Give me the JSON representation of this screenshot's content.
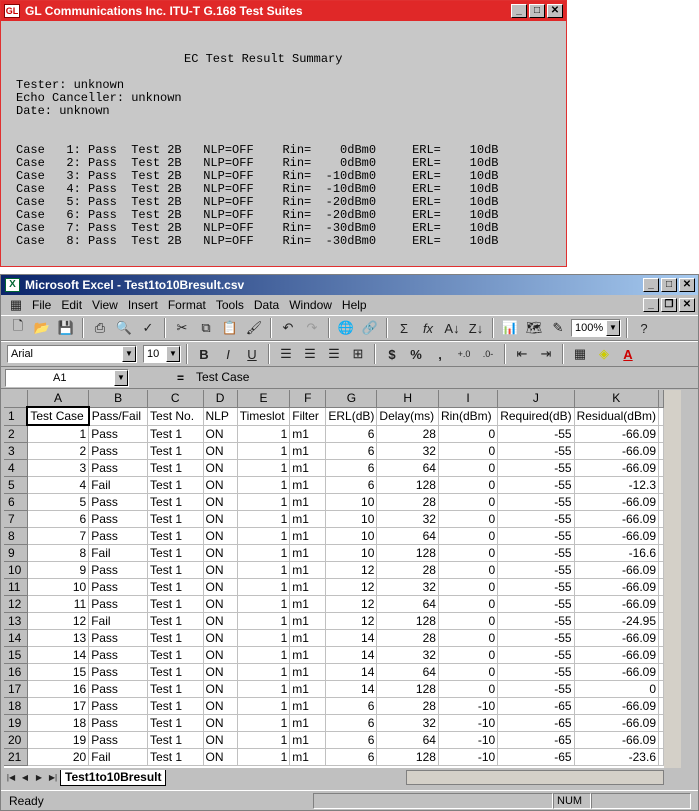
{
  "report_window": {
    "title": "GL Communications Inc. ITU-T G.168 Test Suites",
    "heading": "EC Test Result Summary",
    "tester": "Tester: unknown",
    "canceller": "Echo Canceller: unknown",
    "date": "Date: unknown",
    "lines": [
      "Case   1: Pass  Test 2B   NLP=OFF    Rin=    0dBm0     ERL=    10dB",
      "Case   2: Pass  Test 2B   NLP=OFF    Rin=    0dBm0     ERL=    10dB",
      "Case   3: Pass  Test 2B   NLP=OFF    Rin=  -10dBm0     ERL=    10dB",
      "Case   4: Pass  Test 2B   NLP=OFF    Rin=  -10dBm0     ERL=    10dB",
      "Case   5: Pass  Test 2B   NLP=OFF    Rin=  -20dBm0     ERL=    10dB",
      "Case   6: Pass  Test 2B   NLP=OFF    Rin=  -20dBm0     ERL=    10dB",
      "Case   7: Pass  Test 2B   NLP=OFF    Rin=  -30dBm0     ERL=    10dB",
      "Case   8: Pass  Test 2B   NLP=OFF    Rin=  -30dBm0     ERL=    10dB"
    ]
  },
  "excel": {
    "title": "Microsoft Excel - Test1to10Bresult.csv",
    "menu": [
      "File",
      "Edit",
      "View",
      "Insert",
      "Format",
      "Tools",
      "Data",
      "Window",
      "Help"
    ],
    "zoom": "100%",
    "font": "Arial",
    "font_size": "10",
    "name_box": "A1",
    "formula_eq": "=",
    "formula": "Test Case",
    "columns": [
      "A",
      "B",
      "C",
      "D",
      "E",
      "F",
      "G",
      "H",
      "I",
      "J",
      "K"
    ],
    "header_row": [
      "Test Case",
      "Pass/Fail",
      "Test No.",
      "NLP",
      "Timeslot",
      "Filter",
      "ERL(dB)",
      "Delay(ms)",
      "Rin(dBm)",
      "Required(dB)",
      "Residual(dBm)"
    ],
    "rows": [
      [
        "1",
        "Pass",
        "Test 1",
        "ON",
        "1",
        "m1",
        "6",
        "28",
        "0",
        "-55",
        "-66.09"
      ],
      [
        "2",
        "Pass",
        "Test 1",
        "ON",
        "1",
        "m1",
        "6",
        "32",
        "0",
        "-55",
        "-66.09"
      ],
      [
        "3",
        "Pass",
        "Test 1",
        "ON",
        "1",
        "m1",
        "6",
        "64",
        "0",
        "-55",
        "-66.09"
      ],
      [
        "4",
        "Fail",
        "Test 1",
        "ON",
        "1",
        "m1",
        "6",
        "128",
        "0",
        "-55",
        "-12.3"
      ],
      [
        "5",
        "Pass",
        "Test 1",
        "ON",
        "1",
        "m1",
        "10",
        "28",
        "0",
        "-55",
        "-66.09"
      ],
      [
        "6",
        "Pass",
        "Test 1",
        "ON",
        "1",
        "m1",
        "10",
        "32",
        "0",
        "-55",
        "-66.09"
      ],
      [
        "7",
        "Pass",
        "Test 1",
        "ON",
        "1",
        "m1",
        "10",
        "64",
        "0",
        "-55",
        "-66.09"
      ],
      [
        "8",
        "Fail",
        "Test 1",
        "ON",
        "1",
        "m1",
        "10",
        "128",
        "0",
        "-55",
        "-16.6"
      ],
      [
        "9",
        "Pass",
        "Test 1",
        "ON",
        "1",
        "m1",
        "12",
        "28",
        "0",
        "-55",
        "-66.09"
      ],
      [
        "10",
        "Pass",
        "Test 1",
        "ON",
        "1",
        "m1",
        "12",
        "32",
        "0",
        "-55",
        "-66.09"
      ],
      [
        "11",
        "Pass",
        "Test 1",
        "ON",
        "1",
        "m1",
        "12",
        "64",
        "0",
        "-55",
        "-66.09"
      ],
      [
        "12",
        "Fail",
        "Test 1",
        "ON",
        "1",
        "m1",
        "12",
        "128",
        "0",
        "-55",
        "-24.95"
      ],
      [
        "13",
        "Pass",
        "Test 1",
        "ON",
        "1",
        "m1",
        "14",
        "28",
        "0",
        "-55",
        "-66.09"
      ],
      [
        "14",
        "Pass",
        "Test 1",
        "ON",
        "1",
        "m1",
        "14",
        "32",
        "0",
        "-55",
        "-66.09"
      ],
      [
        "15",
        "Pass",
        "Test 1",
        "ON",
        "1",
        "m1",
        "14",
        "64",
        "0",
        "-55",
        "-66.09"
      ],
      [
        "16",
        "Pass",
        "Test 1",
        "ON",
        "1",
        "m1",
        "14",
        "128",
        "0",
        "-55",
        "0"
      ],
      [
        "17",
        "Pass",
        "Test 1",
        "ON",
        "1",
        "m1",
        "6",
        "28",
        "-10",
        "-65",
        "-66.09"
      ],
      [
        "18",
        "Pass",
        "Test 1",
        "ON",
        "1",
        "m1",
        "6",
        "32",
        "-10",
        "-65",
        "-66.09"
      ],
      [
        "19",
        "Pass",
        "Test 1",
        "ON",
        "1",
        "m1",
        "6",
        "64",
        "-10",
        "-65",
        "-66.09"
      ],
      [
        "20",
        "Fail",
        "Test 1",
        "ON",
        "1",
        "m1",
        "6",
        "128",
        "-10",
        "-65",
        "-23.6"
      ]
    ],
    "sheet_tab": "Test1to10Bresult",
    "status": "Ready",
    "num": "NUM"
  }
}
